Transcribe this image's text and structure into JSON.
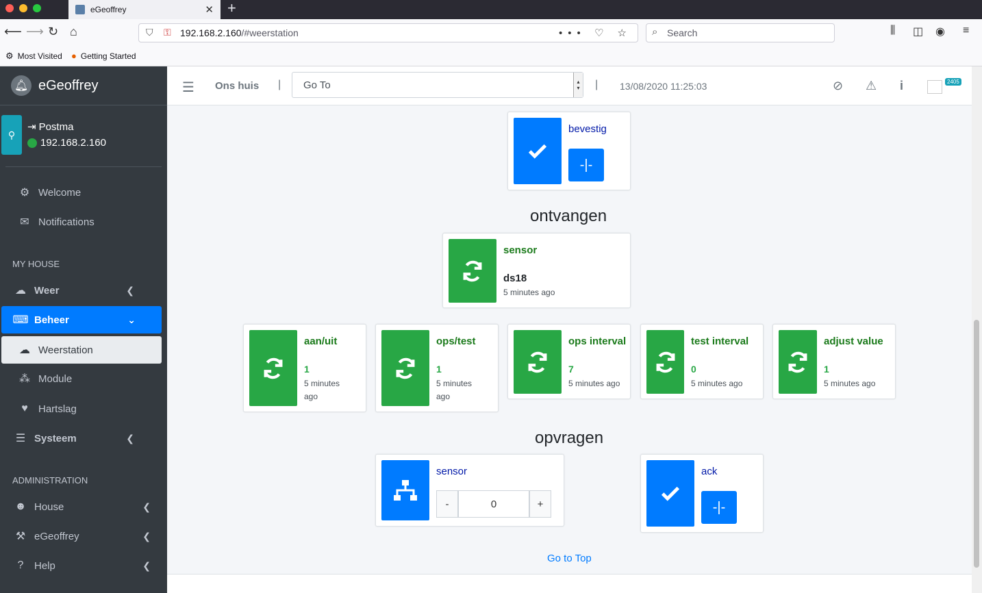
{
  "browser": {
    "tab_title": "eGeoffrey",
    "url_host": "192.168.2.160",
    "url_path": "/#weerstation",
    "search_placeholder": "Search",
    "bookmarks": [
      "Most Visited",
      "Getting Started"
    ]
  },
  "sidebar": {
    "brand": "eGeoffrey",
    "user_name": "Postma",
    "user_ip": "192.168.2.160",
    "items": [
      {
        "label": "Welcome"
      },
      {
        "label": "Notifications"
      }
    ],
    "section_my_house": "MY HOUSE",
    "my_house": [
      {
        "label": "Weer"
      },
      {
        "label": "Beheer"
      },
      {
        "label": "Weerstation"
      },
      {
        "label": "Module"
      },
      {
        "label": "Hartslag"
      },
      {
        "label": "Systeem"
      }
    ],
    "section_admin": "ADMINISTRATION",
    "admin": [
      {
        "label": "House"
      },
      {
        "label": "eGeoffrey"
      },
      {
        "label": "Help"
      }
    ]
  },
  "topbar": {
    "house_name": "Ons huis",
    "goto_label": "Go To",
    "datetime": "13/08/2020 11:25:03",
    "badge_count": "2405"
  },
  "content": {
    "confirm_card": {
      "title": "bevestig"
    },
    "section_receive": "ontvangen",
    "sensor_card": {
      "title": "sensor",
      "value": "ds18",
      "time": "5 minutes ago"
    },
    "widgets": [
      {
        "title": "aan/uit",
        "value": "1",
        "time": "5 minutes ago"
      },
      {
        "title": "ops/test",
        "value": "1",
        "time": "5 minutes ago"
      },
      {
        "title": "ops interval",
        "value": "7",
        "time": "5 minutes ago"
      },
      {
        "title": "test interval",
        "value": "0",
        "time": "5 minutes ago"
      },
      {
        "title": "adjust value",
        "value": "1",
        "time": "5 minutes ago"
      }
    ],
    "section_request": "opvragen",
    "request_sensor": {
      "title": "sensor",
      "minus": "-",
      "value": "0",
      "plus": "+"
    },
    "ack_card": {
      "title": "ack"
    },
    "go_to_top": "Go to Top"
  },
  "colors": {
    "green": "#28a745",
    "blue": "#007bff",
    "sidebar": "#343a40"
  }
}
